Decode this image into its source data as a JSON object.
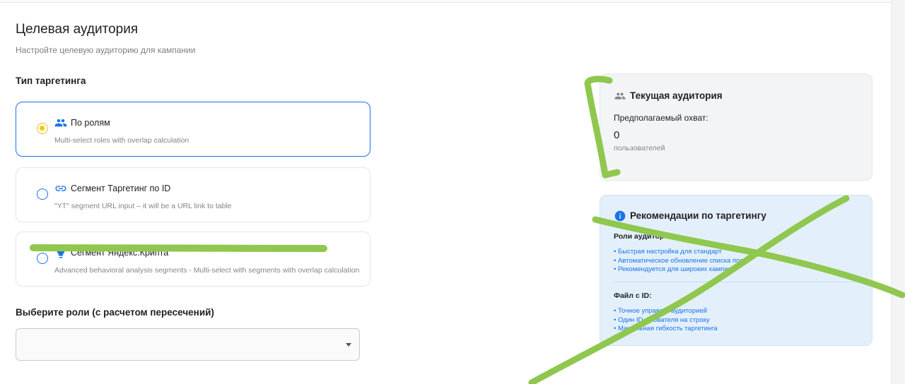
{
  "page": {
    "title": "Целевая аудитория",
    "subtitle": "Настройте целевую аудиторию для кампании"
  },
  "targeting": {
    "section_title": "Тип таргетинга",
    "options": [
      {
        "label": "По ролям",
        "description": "Multi-select roles with overlap calculation",
        "selected": true,
        "icon": "people-icon"
      },
      {
        "label": "Сегмент Таргетинг по ID",
        "description": "\"YT\" segment URL input – it will be a URL link to table",
        "selected": false,
        "icon": "link-icon"
      },
      {
        "label": "Сегмент Яндекс.Крипта",
        "description": "Advanced behavioral analysis segments - Multi-select with segments with overlap calculation",
        "selected": false,
        "icon": "bulb-icon"
      }
    ]
  },
  "roles": {
    "title": "Выберите роли (с расчетом пересечений)",
    "selected_value": ""
  },
  "current_audience": {
    "title": "Текущая аудитория",
    "reach_label": "Предполагаемый охват:",
    "reach_value": "0",
    "reach_unit": "пользователей"
  },
  "recommendations": {
    "title": "Рекомендации по таргетингу",
    "groups": [
      {
        "title": "Роли аудитор",
        "items": [
          "Быстрая настройка для стандарт",
          "Автоматическое обновление списка пол",
          "Рекомендуется для широких кампан"
        ]
      },
      {
        "title": "Файл с ID:",
        "items": [
          "Точное управл  е аудиторией",
          "Один ID п   зователя на строку",
          "Макс   льная гибкость таргетинга"
        ]
      }
    ]
  },
  "colors": {
    "accent": "#1a73e8",
    "selected_radio": "#f2c811",
    "scribble": "#8fc74f"
  }
}
